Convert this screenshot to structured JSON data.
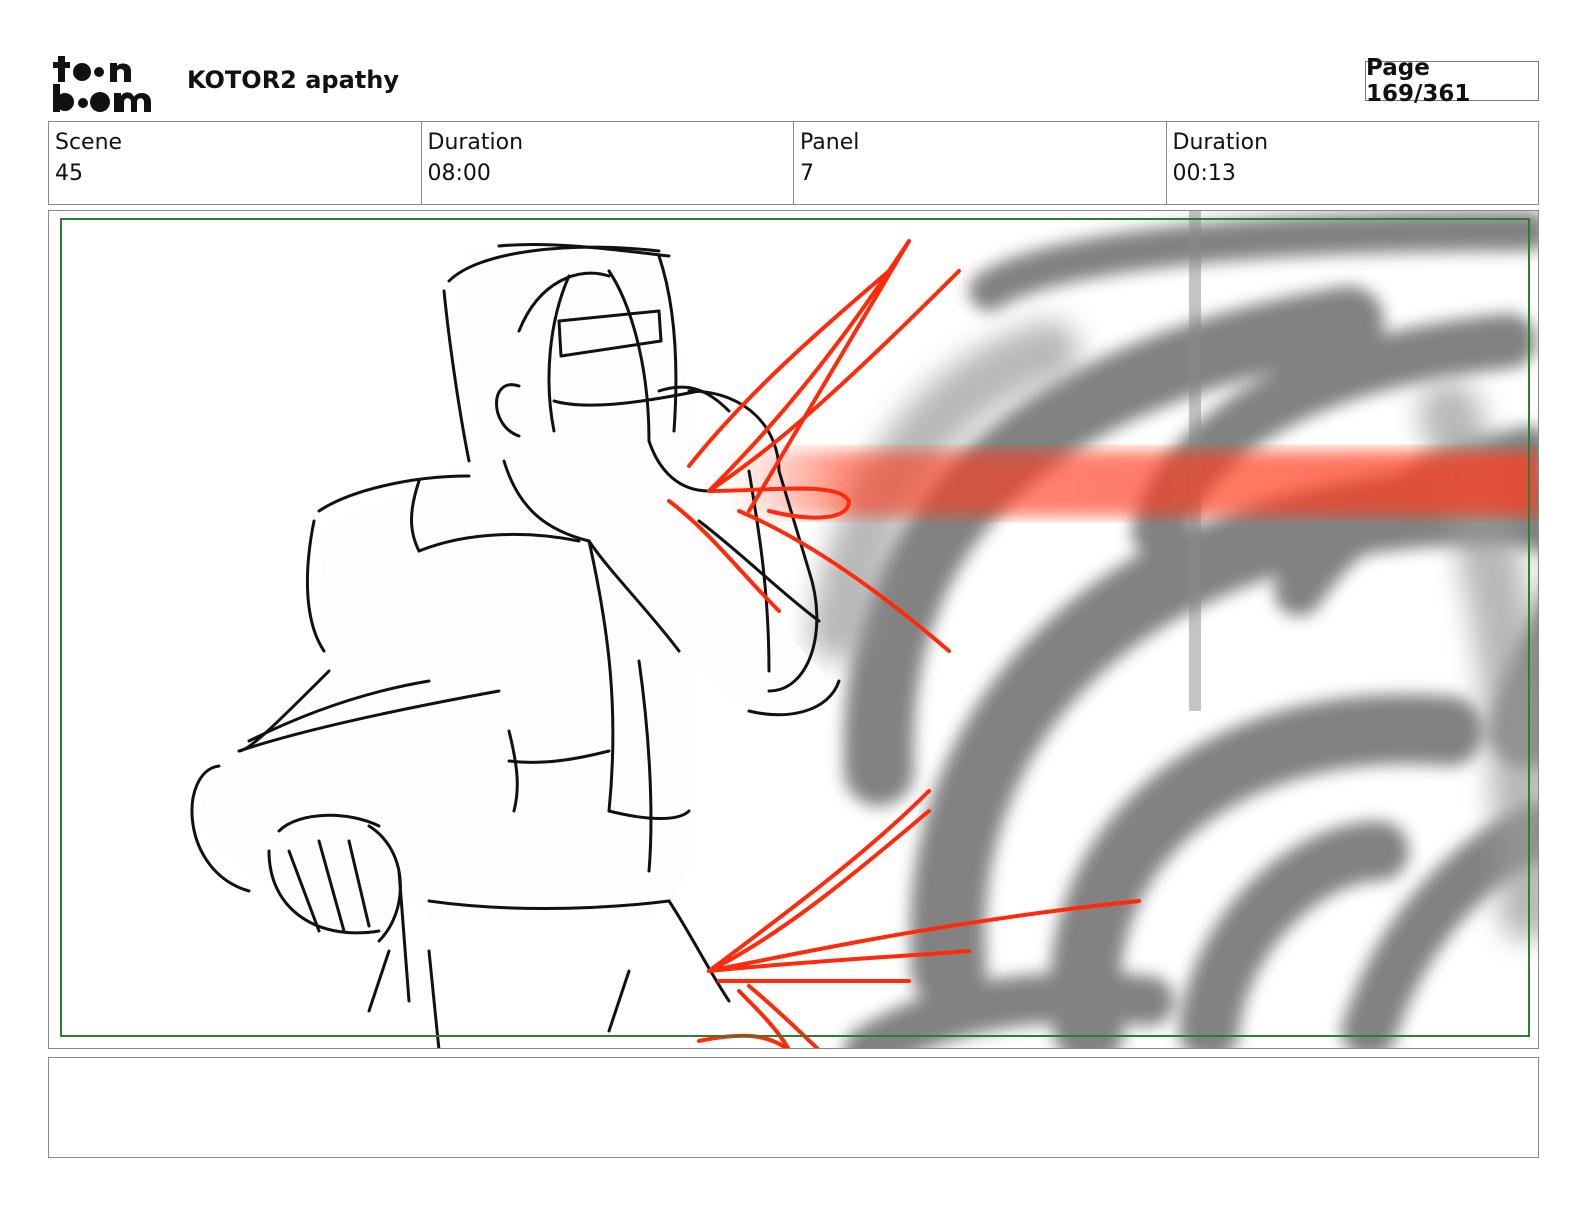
{
  "header": {
    "logo_icon": "toonboom-logo-icon",
    "project_title": "KOTOR2 apathy",
    "page_label": "Page 169/361"
  },
  "info": [
    {
      "label": "Scene",
      "value": "45"
    },
    {
      "label": "Duration",
      "value": "08:00"
    },
    {
      "label": "Panel",
      "value": "7"
    },
    {
      "label": "Duration",
      "value": "00:13"
    }
  ],
  "panel": {
    "image_icon": "storyboard-sketch-image",
    "safe_frame_color": "#2e7d32",
    "accent_red": "#ff2a0a"
  },
  "notes": {
    "text": ""
  }
}
